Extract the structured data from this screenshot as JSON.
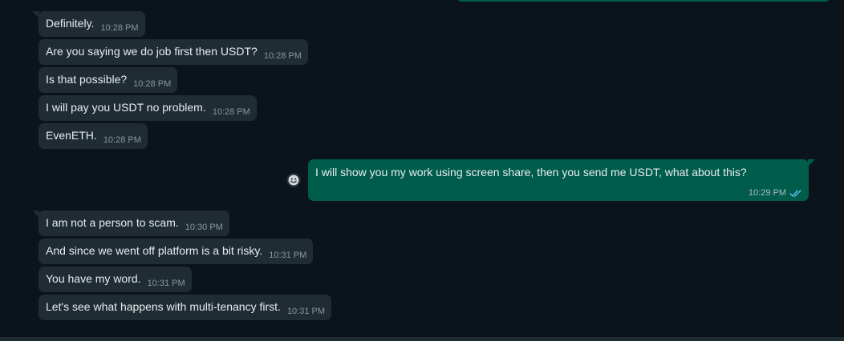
{
  "chat": {
    "incoming_group_1": [
      {
        "text": "Definitely.",
        "time": "10:28 PM"
      },
      {
        "text": "Are you saying we do job first then USDT?",
        "time": "10:28 PM"
      },
      {
        "text": "Is that possible?",
        "time": "10:28 PM"
      },
      {
        "text": "I will pay you USDT no problem.",
        "time": "10:28 PM"
      },
      {
        "text": "EvenETH.",
        "time": "10:28 PM"
      }
    ],
    "outgoing": {
      "text": "I will show you my work using screen share, then you send me USDT, what about this?",
      "time": "10:29 PM",
      "status_icon": "double-check-read-icon"
    },
    "incoming_group_2": [
      {
        "text": "I am not a person to scam.",
        "time": "10:30 PM"
      },
      {
        "text": "And since we went off platform is a bit risky.",
        "time": "10:31 PM"
      },
      {
        "text": "You have my word.",
        "time": "10:31 PM"
      },
      {
        "text": "Let's see what happens with multi-tenancy first.",
        "time": "10:31 PM"
      }
    ],
    "reaction_button_icon": "emoji-smile-icon"
  },
  "colors": {
    "background": "#0b141a",
    "incoming_bubble": "#1f2c34",
    "outgoing_bubble": "#005c4b",
    "read_check": "#53bdeb",
    "timestamp": "#8696a0"
  }
}
